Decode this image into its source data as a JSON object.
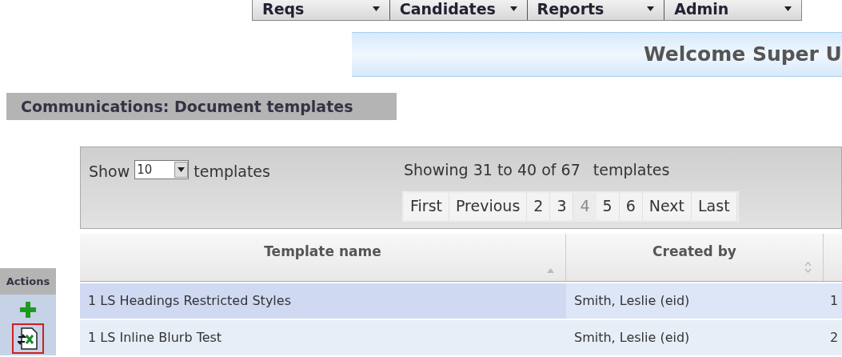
{
  "menu": [
    {
      "label": "Reqs"
    },
    {
      "label": "Candidates"
    },
    {
      "label": "Reports"
    },
    {
      "label": "Admin"
    }
  ],
  "welcome": "Welcome Super U",
  "page_title": "Communications: Document templates",
  "length": {
    "before": "Show",
    "value": "10",
    "after": "templates"
  },
  "info": {
    "range": "Showing 31 to 40 of 67",
    "unit": "templates"
  },
  "pager": [
    {
      "label": "First",
      "selected": false
    },
    {
      "label": "Previous",
      "selected": false
    },
    {
      "label": "2",
      "selected": false
    },
    {
      "label": "3",
      "selected": false
    },
    {
      "label": "4",
      "selected": true
    },
    {
      "label": "5",
      "selected": false
    },
    {
      "label": "6",
      "selected": false
    },
    {
      "label": "Next",
      "selected": false
    },
    {
      "label": "Last",
      "selected": false
    }
  ],
  "actions": {
    "title": "Actions"
  },
  "table": {
    "columns": [
      {
        "label": "Template name",
        "sorted": true
      },
      {
        "label": "Created by",
        "sorted": false
      }
    ],
    "rows": [
      {
        "name": "1 LS Headings Restricted Styles",
        "created_by": "Smith, Leslie (eid)",
        "column_3": "1",
        "selected": true
      },
      {
        "name": "1 LS Inline Blurb Test",
        "created_by": "Smith, Leslie (eid)",
        "column_3": "2",
        "selected": false
      }
    ]
  }
}
